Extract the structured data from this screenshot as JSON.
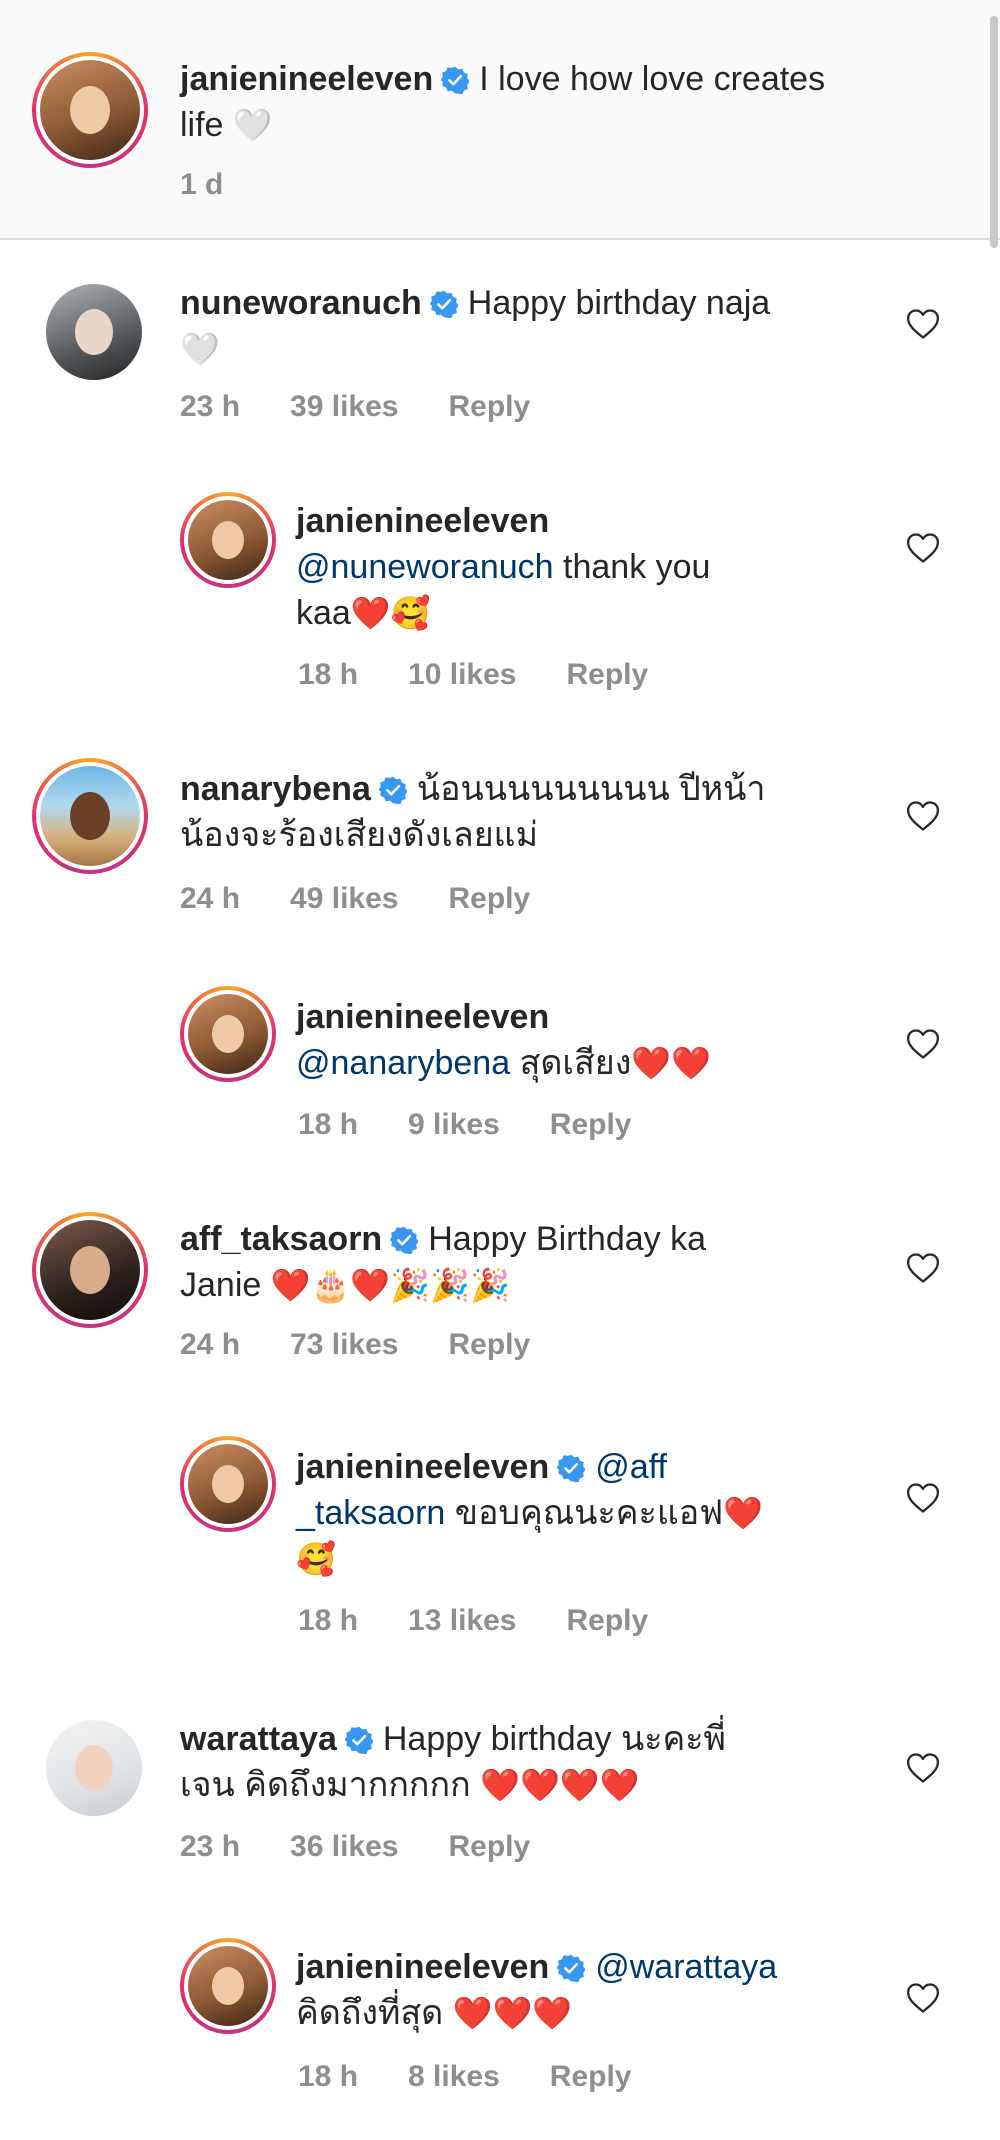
{
  "caption": {
    "username": "janienineeleven",
    "text": "I love how love creates",
    "text2": "life",
    "emoji": "🤍",
    "time": "1 d"
  },
  "comments": [
    {
      "username": "nuneworanuch",
      "text": "Happy birthday naja",
      "text2": "🤍",
      "time": "23 h",
      "likes": "39 likes",
      "reply": "Reply"
    },
    {
      "username": "janienineeleven",
      "mention": "@nuneworanuch",
      "text": " thank you",
      "text2": "kaa",
      "emoji": "❤️🥰",
      "time": "18 h",
      "likes": "10 likes",
      "reply": "Reply"
    },
    {
      "username": "nanarybena",
      "text": "น้อนนนนนนนนน ปีหน้า",
      "text2": "น้องจะร้องเสียงดังเลยแม่",
      "time": "24 h",
      "likes": "49 likes",
      "reply": "Reply"
    },
    {
      "username": "janienineeleven",
      "mention": "@nanarybena",
      "text": " สุดเสียง",
      "emoji": "❤️❤️",
      "time": "18 h",
      "likes": "9 likes",
      "reply": "Reply"
    },
    {
      "username": "aff_taksaorn",
      "text": "Happy Birthday ka",
      "text2": "Janie ",
      "emoji": "❤️🎂❤️🎉🎉🎉",
      "time": "24 h",
      "likes": "73 likes",
      "reply": "Reply"
    },
    {
      "username": "janienineeleven",
      "mention": "@aff",
      "mention2": "_taksaorn",
      "text": " ขอบคุณนะคะแอฟ",
      "emoji": "❤️",
      "emoji2": "🥰",
      "time": "18 h",
      "likes": "13 likes",
      "reply": "Reply"
    },
    {
      "username": "warattaya",
      "text": "Happy birthday นะคะพี่",
      "text2": "เจน คิดถึงมากกกกก ",
      "emoji": "❤️❤️❤️❤️",
      "time": "23 h",
      "likes": "36 likes",
      "reply": "Reply"
    },
    {
      "username": "janienineeleven",
      "mention": "@warattaya",
      "text2": "คิดถึงที่สุด ",
      "emoji": "❤️❤️❤️",
      "time": "18 h",
      "likes": "8 likes",
      "reply": "Reply"
    }
  ],
  "colors": {
    "verified": "#3897f0",
    "meta": "#8e8e8e",
    "mention": "#00376b",
    "heart": "#e0142b"
  },
  "icons": [
    "verified-badge-icon",
    "like-heart-icon"
  ]
}
